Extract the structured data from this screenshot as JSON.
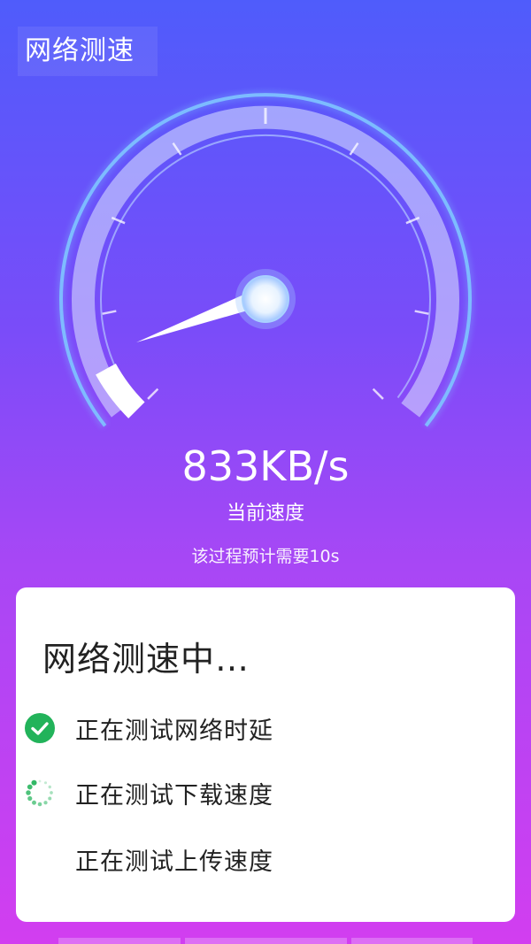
{
  "header": {
    "title": "网络测速"
  },
  "meter": {
    "speed": "833KB/s",
    "speed_label": "当前速度",
    "estimate": "该过程预计需要10s",
    "progress_fraction": 0.06
  },
  "card": {
    "title": "网络测速中…",
    "steps": [
      {
        "label": "正在测试网络时延",
        "status": "done"
      },
      {
        "label": "正在测试下载速度",
        "status": "loading"
      },
      {
        "label": "正在测试上传速度",
        "status": "pending"
      }
    ]
  },
  "colors": {
    "bg_top": "#4f5cfb",
    "bg_bottom": "#d23ef0",
    "success": "#22b35a"
  }
}
